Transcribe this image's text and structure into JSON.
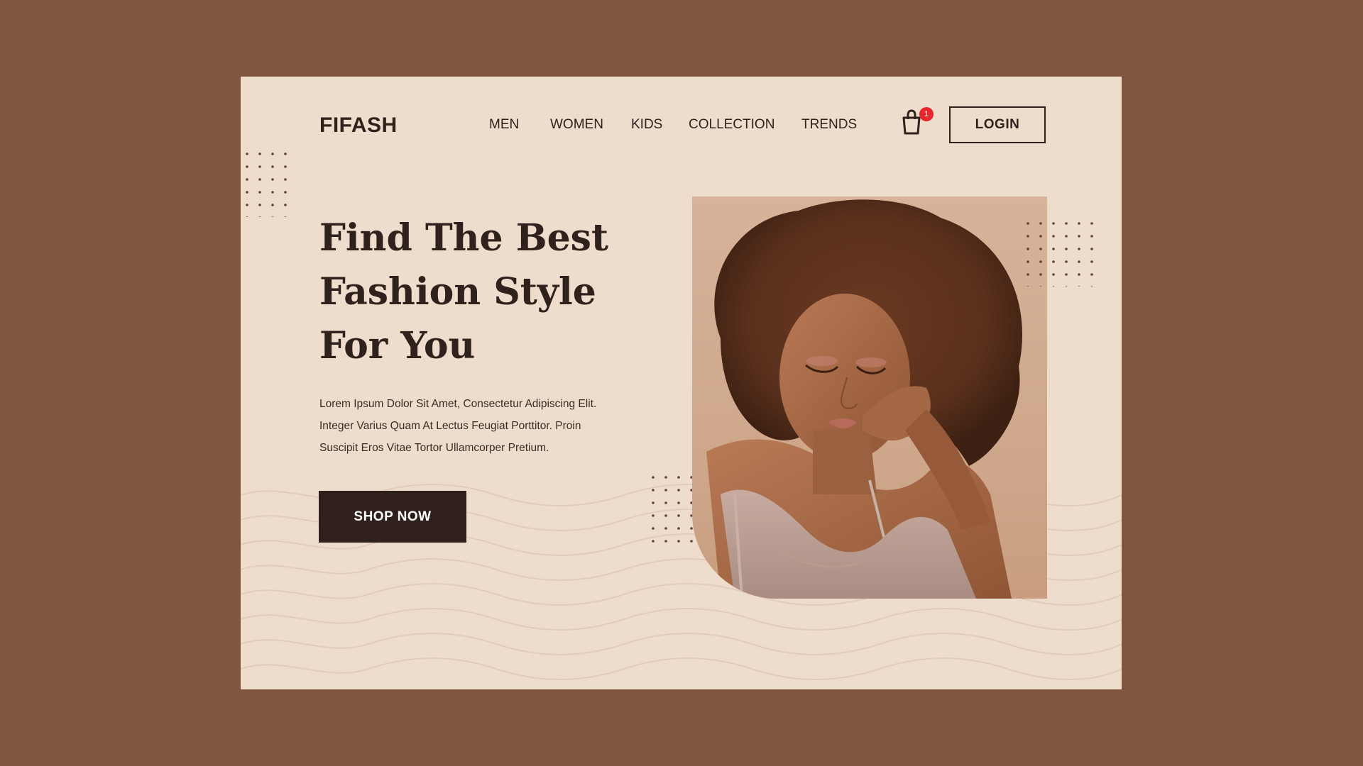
{
  "brand": {
    "logo": "FIFASH"
  },
  "nav": {
    "items": [
      {
        "label": "MEN"
      },
      {
        "label": "WOMEN"
      },
      {
        "label": "KIDS"
      },
      {
        "label": "COLLECTION"
      },
      {
        "label": "TRENDS"
      }
    ]
  },
  "cart": {
    "icon": "shopping-bag-icon",
    "badge_count": "1"
  },
  "header": {
    "login_label": "LOGIN"
  },
  "hero": {
    "headline_lines": [
      "Find The Best",
      "Fashion Style",
      "For You"
    ],
    "description_lines": [
      "Lorem Ipsum Dolor Sit Amet, Consectetur Adipiscing Elit.",
      "Integer Varius Quam At Lectus Feugiat Porttitor. Proin",
      "Suscipit Eros Vitae Tortor Ullamcorper Pretium."
    ],
    "cta_label": "SHOP NOW"
  },
  "colors": {
    "page_background": "#815641",
    "card_background": "#eeddcc",
    "text_dark": "#2f211c",
    "badge_red": "#e6272d"
  }
}
